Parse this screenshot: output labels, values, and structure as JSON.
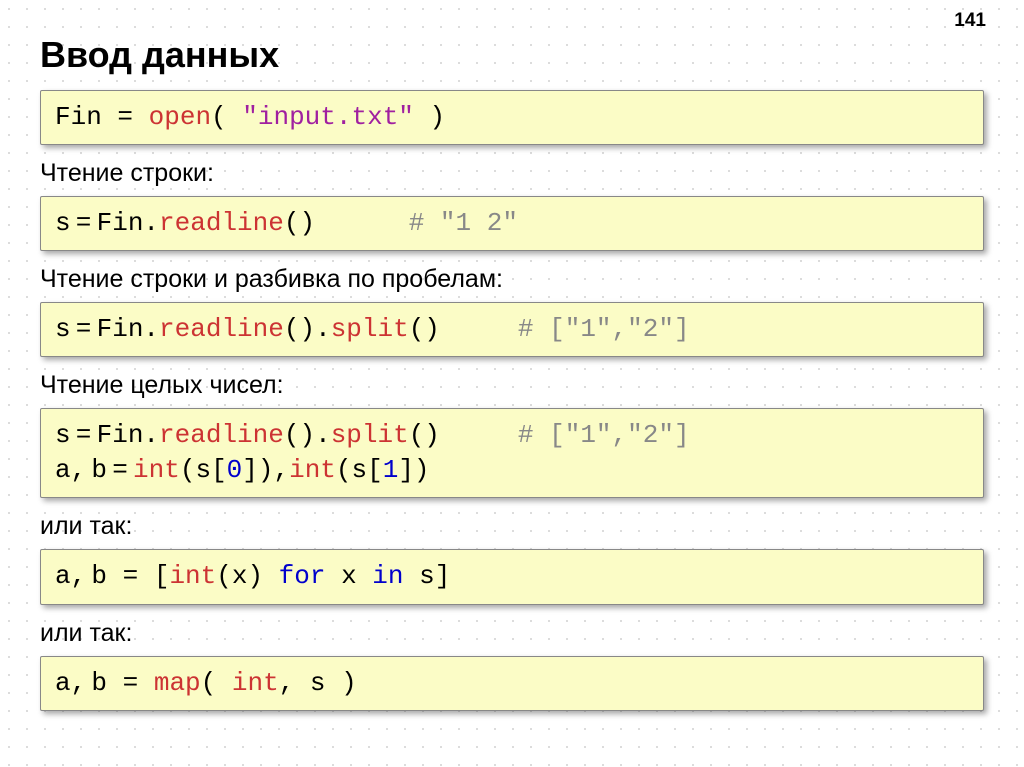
{
  "pageNumber": "141",
  "title": "Ввод данных",
  "blocks": [
    {
      "type": "code",
      "tokens": [
        {
          "t": "Fin ",
          "c": "var"
        },
        {
          "t": "=",
          "c": "var"
        },
        {
          "t": " open",
          "c": "fn"
        },
        {
          "t": "( ",
          "c": "var"
        },
        {
          "t": "\"input.txt\"",
          "c": "str"
        },
        {
          "t": " )",
          "c": "var"
        }
      ]
    },
    {
      "type": "label",
      "text": "Чтение строки:"
    },
    {
      "type": "code",
      "tokens": [
        {
          "t": "s",
          "c": "var"
        },
        {
          "t": " = ",
          "c": "var",
          "tight": true
        },
        {
          "t": "Fin.",
          "c": "var"
        },
        {
          "t": "readline",
          "c": "fn"
        },
        {
          "t": "()      ",
          "c": "var"
        },
        {
          "t": "# \"1 2\"",
          "c": "comment"
        }
      ]
    },
    {
      "type": "label",
      "text": "Чтение строки и разбивка по пробелам:"
    },
    {
      "type": "code",
      "tokens": [
        {
          "t": "s",
          "c": "var"
        },
        {
          "t": " = ",
          "c": "var",
          "tight": true
        },
        {
          "t": "Fin.",
          "c": "var"
        },
        {
          "t": "readline",
          "c": "fn"
        },
        {
          "t": "().",
          "c": "var"
        },
        {
          "t": "split",
          "c": "fn"
        },
        {
          "t": "()     ",
          "c": "var"
        },
        {
          "t": "# [\"1\",\"2\"]",
          "c": "comment"
        }
      ]
    },
    {
      "type": "label",
      "text": "Чтение целых чисел:"
    },
    {
      "type": "code",
      "tokens": [
        {
          "t": "s",
          "c": "var"
        },
        {
          "t": " = ",
          "c": "var",
          "tight": true
        },
        {
          "t": "Fin.",
          "c": "var"
        },
        {
          "t": "readline",
          "c": "fn"
        },
        {
          "t": "().",
          "c": "var"
        },
        {
          "t": "split",
          "c": "fn"
        },
        {
          "t": "()     ",
          "c": "var"
        },
        {
          "t": "# [\"1\",\"2\"]",
          "c": "comment"
        },
        {
          "t": "\n",
          "c": "var"
        },
        {
          "t": "a,",
          "c": "var"
        },
        {
          "t": " ",
          "c": "var",
          "tight": true
        },
        {
          "t": "b",
          "c": "var"
        },
        {
          "t": " = ",
          "c": "var",
          "tight": true
        },
        {
          "t": "int",
          "c": "fn"
        },
        {
          "t": "(s[",
          "c": "var"
        },
        {
          "t": "0",
          "c": "kw"
        },
        {
          "t": "]),",
          "c": "var"
        },
        {
          "t": "int",
          "c": "fn"
        },
        {
          "t": "(s[",
          "c": "var"
        },
        {
          "t": "1",
          "c": "kw"
        },
        {
          "t": "])",
          "c": "var"
        }
      ]
    },
    {
      "type": "label",
      "text": "или так:"
    },
    {
      "type": "code",
      "tokens": [
        {
          "t": "a,",
          "c": "var"
        },
        {
          "t": " ",
          "c": "var",
          "tight": true
        },
        {
          "t": "b = [",
          "c": "var"
        },
        {
          "t": "int",
          "c": "fn"
        },
        {
          "t": "(x) ",
          "c": "var"
        },
        {
          "t": "for",
          "c": "kw"
        },
        {
          "t": " x ",
          "c": "var"
        },
        {
          "t": "in",
          "c": "kw"
        },
        {
          "t": " s]",
          "c": "var"
        }
      ]
    },
    {
      "type": "label",
      "text": "или так:"
    },
    {
      "type": "code",
      "tokens": [
        {
          "t": "a,",
          "c": "var"
        },
        {
          "t": " ",
          "c": "var",
          "tight": true
        },
        {
          "t": "b = ",
          "c": "var"
        },
        {
          "t": "map",
          "c": "fn"
        },
        {
          "t": "( ",
          "c": "var"
        },
        {
          "t": "int",
          "c": "fn"
        },
        {
          "t": ", s )",
          "c": "var"
        }
      ]
    }
  ]
}
